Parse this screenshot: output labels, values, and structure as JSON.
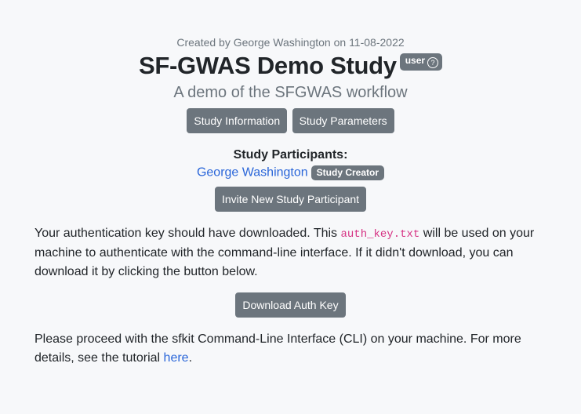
{
  "header": {
    "created_text": "Created by George Washington on 11-08-2022",
    "title": "SF-GWAS Demo Study",
    "role_badge": "user",
    "role_help_icon": "question-circle-icon",
    "subtitle": "A demo of the SFGWAS workflow"
  },
  "buttons": {
    "study_information": "Study Information",
    "study_parameters": "Study Parameters",
    "invite_participant": "Invite New Study Participant",
    "download_auth_key": "Download Auth Key"
  },
  "participants": {
    "heading": "Study Participants:",
    "items": [
      {
        "name": "George Washington",
        "badge": "Study Creator"
      }
    ]
  },
  "auth": {
    "text_before": "Your authentication key should have downloaded. This ",
    "filename": "auth_key.txt",
    "text_after": " will be used on your machine to authenticate with the command-line interface. If it didn't download, you can download it by clicking the button below."
  },
  "cli": {
    "text_before": "Please proceed with the sfkit Command-Line Interface (CLI) on your machine. For more details, see the tutorial ",
    "link_text": "here",
    "text_after": "."
  },
  "colors": {
    "secondary": "#6c757d",
    "link": "#2a66d9",
    "code": "#d63384",
    "background": "#f7f8fa"
  }
}
